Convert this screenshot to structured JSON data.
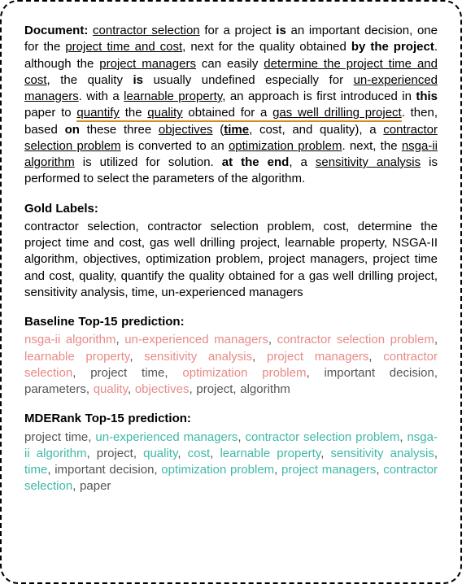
{
  "document": {
    "label": "Document:"
  },
  "gold": {
    "label": "Gold Labels:"
  },
  "baseline": {
    "label": "Baseline Top-15 prediction:",
    "items": [
      {
        "text": "nsga-ii algorithm",
        "correct": true
      },
      {
        "text": "un-experienced managers",
        "correct": true
      },
      {
        "text": "contractor selection problem",
        "correct": true
      },
      {
        "text": "learnable property",
        "correct": true
      },
      {
        "text": "sensitivity analysis",
        "correct": true
      },
      {
        "text": "project managers",
        "correct": true
      },
      {
        "text": "contractor selection",
        "correct": true
      },
      {
        "text": "project time",
        "correct": false
      },
      {
        "text": "optimization problem",
        "correct": true
      },
      {
        "text": "important decision",
        "correct": false
      },
      {
        "text": "parameters",
        "correct": false
      },
      {
        "text": "quality",
        "correct": true
      },
      {
        "text": "objectives",
        "correct": true
      },
      {
        "text": "project",
        "correct": false
      },
      {
        "text": "algorithm",
        "correct": false
      }
    ]
  },
  "mderank": {
    "label": "MDERank Top-15 prediction:",
    "items": [
      {
        "text": "project time",
        "correct": false
      },
      {
        "text": "un-experienced managers",
        "correct": true
      },
      {
        "text": "contractor selection problem",
        "correct": true
      },
      {
        "text": "nsga-ii algorithm",
        "correct": true
      },
      {
        "text": "project",
        "correct": false
      },
      {
        "text": "quality",
        "correct": true
      },
      {
        "text": "cost",
        "correct": true
      },
      {
        "text": "learnable property",
        "correct": true
      },
      {
        "text": "sensitivity analysis",
        "correct": true
      },
      {
        "text": "time",
        "correct": true
      },
      {
        "text": "important decision",
        "correct": false
      },
      {
        "text": "optimization problem",
        "correct": true
      },
      {
        "text": "project managers",
        "correct": true
      },
      {
        "text": "contractor selection",
        "correct": true
      },
      {
        "text": "paper",
        "correct": false
      }
    ]
  },
  "doc_text": {
    "p1": "contractor selection",
    "p2": " for a project ",
    "p3": "is",
    "p4": " an important decision, one for the ",
    "p5": "project time and cost",
    "p6": ", next for the quality obtained ",
    "p7": "by the project",
    "p8": ". although the ",
    "p9": "project managers",
    "p10": " can easily ",
    "p11": "determine the project time and",
    "p12": " ",
    "p13": "cost",
    "p14": ", the quality ",
    "p14b": "is",
    "p14c": " usually undefined especially for ",
    "p15": "un-experienced managers",
    "p16": ". with a ",
    "p17": "learnable property",
    "p18": ", an approach is first introduced in ",
    "p18b": "this",
    "p18c": " paper to ",
    "p19": "quantify",
    "p20": " the ",
    "p21": "quality",
    "p22": " obtained for a ",
    "p23": "gas well drilling project",
    "p24": ". then, based ",
    "p24b": "on",
    "p24c": " these three ",
    "p25": "objectives",
    "p26": " (",
    "p27": "time",
    "p28": ", cost, and quality), a ",
    "p29": "contractor selection problem",
    "p30": " is converted to an ",
    "p31": "optimization problem",
    "p32": ". next, the ",
    "p33": "nsga-ii algorithm",
    "p34": " is utilized for solution. ",
    "p35": "at the end",
    "p36": ", a ",
    "p37": "sensitivity analysis",
    "p38": " is performed to select the parameters of the algorithm."
  },
  "gold_text": "contractor selection, contractor selection problem, cost, determine the project time and cost, gas well drilling project, learnable property, NSGA-II algorithm, objectives, optimization problem, project managers, project time and cost, quality, quantify the quality obtained for a gas well drilling project, sensitivity analysis, time, un-experienced managers"
}
